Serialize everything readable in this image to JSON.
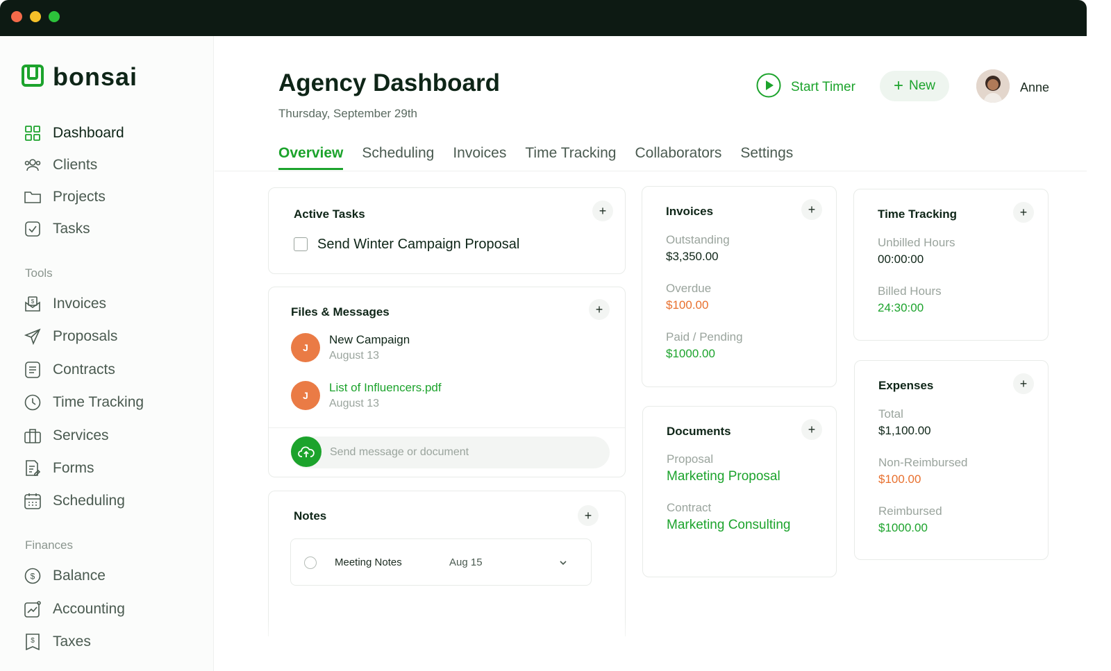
{
  "sidebar": {
    "logo": "bonsai",
    "items": [
      {
        "label": "Dashboard",
        "icon": "grid-icon"
      },
      {
        "label": "Clients",
        "icon": "users-icon"
      },
      {
        "label": "Projects",
        "icon": "folder-icon"
      },
      {
        "label": "Tasks",
        "icon": "checkbox-icon"
      }
    ],
    "tools_label": "Tools",
    "tools": [
      {
        "label": "Invoices",
        "icon": "invoice-icon"
      },
      {
        "label": "Proposals",
        "icon": "send-icon"
      },
      {
        "label": "Contracts",
        "icon": "document-icon"
      },
      {
        "label": "Time Tracking",
        "icon": "clock-icon"
      },
      {
        "label": "Services",
        "icon": "briefcase-icon"
      },
      {
        "label": "Forms",
        "icon": "form-icon"
      },
      {
        "label": "Scheduling",
        "icon": "calendar-icon"
      }
    ],
    "finances_label": "Finances",
    "finances": [
      {
        "label": "Balance",
        "icon": "dollar-icon"
      },
      {
        "label": "Accounting",
        "icon": "chart-icon"
      },
      {
        "label": "Taxes",
        "icon": "receipt-icon"
      }
    ]
  },
  "header": {
    "title": "Agency Dashboard",
    "date": "Thursday, September 29th",
    "start_timer": "Start Timer",
    "new_button": "New",
    "user_name": "Anne"
  },
  "tabs": [
    "Overview",
    "Scheduling",
    "Invoices",
    "Time Tracking",
    "Collaborators",
    "Settings"
  ],
  "active_tasks": {
    "title": "Active Tasks",
    "tasks": [
      "Send Winter Campaign Proposal"
    ]
  },
  "files_messages": {
    "title": "Files & Messages",
    "items": [
      {
        "initial": "J",
        "title": "New Campaign",
        "date": "August 13"
      },
      {
        "initial": "J",
        "title": "List of Influencers.pdf",
        "date": "August 13"
      }
    ],
    "send_placeholder": "Send message or document"
  },
  "notes": {
    "title": "Notes",
    "items": [
      {
        "title": "Meeting Notes",
        "date": "Aug 15"
      }
    ]
  },
  "invoices": {
    "title": "Invoices",
    "outstanding_label": "Outstanding",
    "outstanding": "$3,350.00",
    "overdue_label": "Overdue",
    "overdue": "$100.00",
    "paid_label": "Paid / Pending",
    "paid": "$1000.00"
  },
  "documents": {
    "title": "Documents",
    "proposal_label": "Proposal",
    "proposal": "Marketing Proposal",
    "contract_label": "Contract",
    "contract": "Marketing Consulting"
  },
  "time_tracking": {
    "title": "Time Tracking",
    "unbilled_label": "Unbilled Hours",
    "unbilled": "00:00:00",
    "billed_label": "Billed Hours",
    "billed": "24:30:00"
  },
  "expenses": {
    "title": "Expenses",
    "total_label": "Total",
    "total": "$1,100.00",
    "non_reimbursed_label": "Non-Reimbursed",
    "non_reimbursed": "$100.00",
    "reimbursed_label": "Reimbursed",
    "reimbursed": "$1000.00"
  },
  "colors": {
    "brand_green": "#1ca32c",
    "dark": "#0e2517",
    "orange": "#e8702e",
    "titlebar": "#0d1a13"
  }
}
